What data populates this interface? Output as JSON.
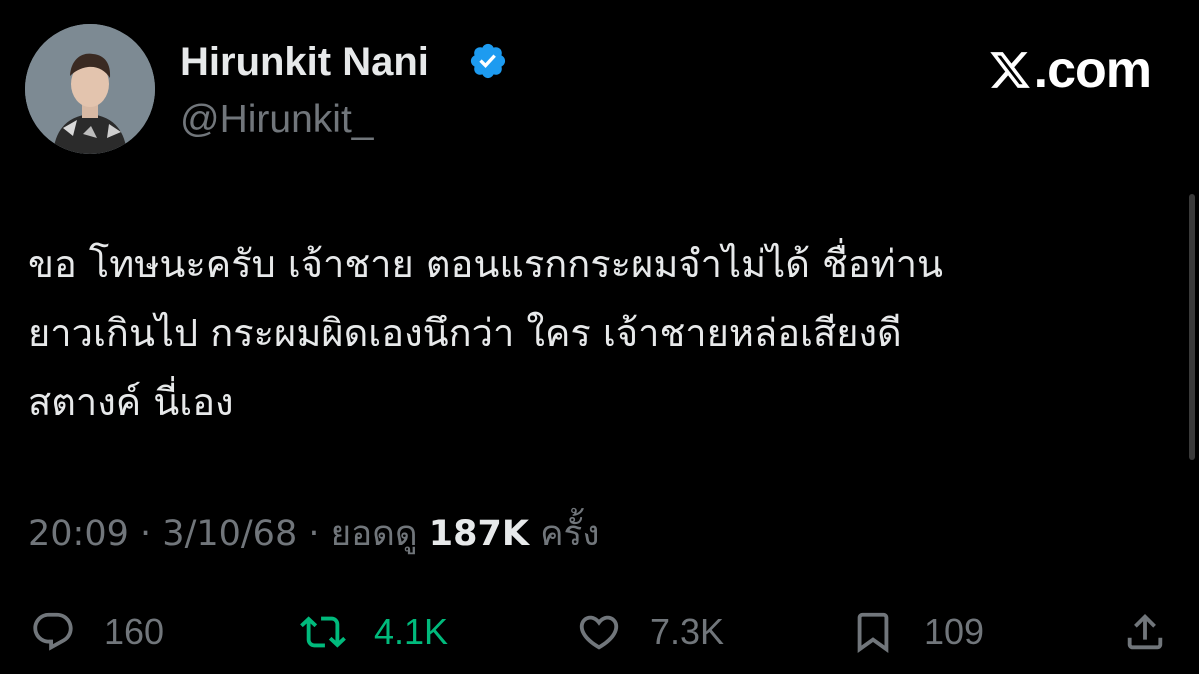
{
  "author": {
    "display_name": "Hirunkit Nani",
    "handle": "@Hirunkit_",
    "verified": true,
    "verified_color": "#1d9bf0"
  },
  "brand": {
    "text": ".com",
    "icon": "x-logo-icon"
  },
  "tweet": {
    "lines": [
      "ขอ โทษนะครับ เจ้าชาย ตอนแรกกระผมจำไม่ได้ ชื่อท่าน",
      "ยาวเกินไป กระผมผิดเองนึกว่า ใคร เจ้าชายหล่อเสียงดี",
      "สตางค์ นี่เอง"
    ]
  },
  "meta": {
    "time": "20:09",
    "separator": "·",
    "date": "3/10/68",
    "views_prefix": "ยอดดู",
    "views_count": "187K",
    "views_suffix": "ครั้ง"
  },
  "actions": {
    "reply": {
      "icon": "reply-icon",
      "count": "160"
    },
    "retweet": {
      "icon": "retweet-icon",
      "count": "4.1K",
      "color": "#00ba7c"
    },
    "like": {
      "icon": "heart-icon",
      "count": "7.3K"
    },
    "bookmark": {
      "icon": "bookmark-icon",
      "count": "109"
    },
    "share": {
      "icon": "share-icon"
    }
  },
  "colors": {
    "background": "#000000",
    "text_primary": "#e7e9ea",
    "text_secondary": "#71767b"
  }
}
